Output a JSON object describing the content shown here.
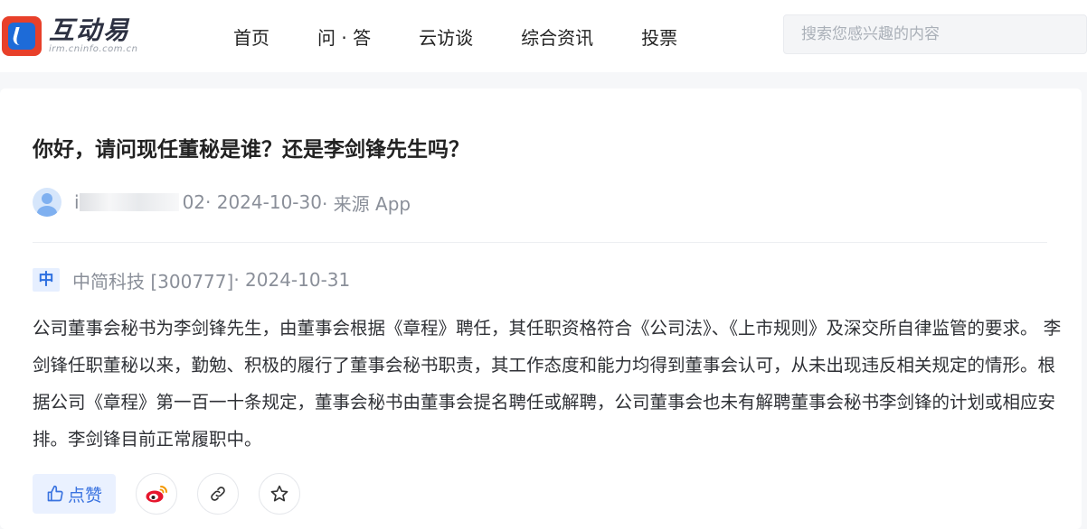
{
  "header": {
    "logo_cn": "互动易",
    "logo_en": "irm.cninfo.com.cn",
    "nav": [
      "首页",
      "问 · 答",
      "云访谈",
      "综合资讯",
      "投票"
    ],
    "search_placeholder": "搜索您感兴趣的内容"
  },
  "question": {
    "title": "你好，请问现任董秘是谁？还是李剑锋先生吗？",
    "asker_prefix": "i",
    "asker_suffix": "02",
    "date": " · 2024-10-30",
    "source": " · 来源 App"
  },
  "answer": {
    "badge": "中",
    "company": "中简科技 [300777]",
    "date": " · 2024-10-31",
    "text": "公司董事会秘书为李剑锋先生，由董事会根据《章程》聘任，其任职资格符合《公司法》、《上市规则》及深交所自律监管的要求。 李剑锋任职董秘以来，勤勉、积极的履行了董事会秘书职责，其工作态度和能力均得到董事会认可，从未出现违反相关规定的情形。根据公司《章程》第一百一十条规定，董事会秘书由董事会提名聘任或解聘，公司董事会也未有解聘董事会秘书李剑锋的计划或相应安排。李剑锋目前正常履职中。"
  },
  "actions": {
    "like_label": "点赞",
    "icons": [
      "thumb-up-icon",
      "weibo-icon",
      "link-icon",
      "star-icon"
    ],
    "accent": "#3a73e0"
  }
}
